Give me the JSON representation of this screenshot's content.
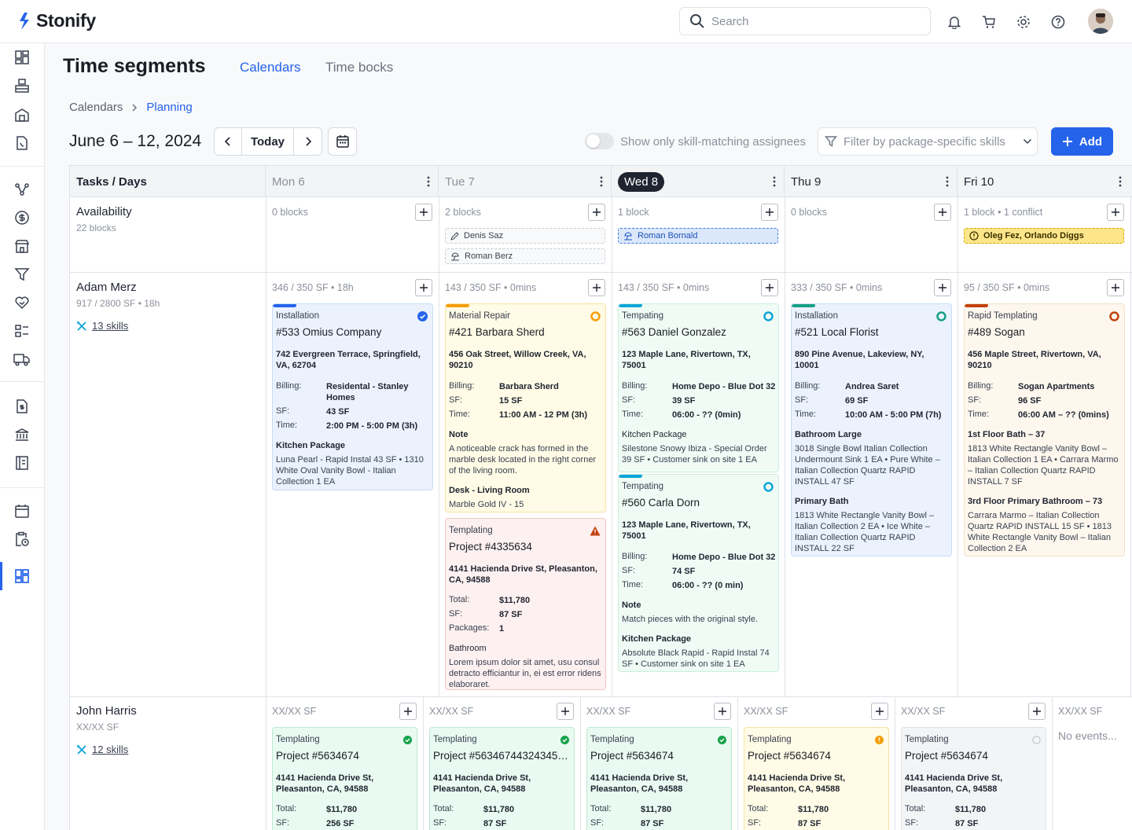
{
  "app": {
    "name": "Stonify"
  },
  "topbar": {
    "search_placeholder": "Search"
  },
  "page": {
    "title": "Time segments",
    "tabs": [
      "Calendars",
      "Time bocks"
    ],
    "active_tab": "Calendars"
  },
  "breadcrumb": {
    "root": "Calendars",
    "current": "Planning"
  },
  "toolbar": {
    "date_range": "June 6 – 12, 2024",
    "today_label": "Today",
    "toggle_label": "Show only skill-matching assignees",
    "filter_placeholder": "Filter by package-specific skills",
    "add_label": "Add"
  },
  "grid": {
    "corner_label": "Tasks / Days",
    "days": [
      {
        "label": "Mon 6",
        "state": "past"
      },
      {
        "label": "Tue 7",
        "state": "past"
      },
      {
        "label": "Wed 8",
        "state": "today"
      },
      {
        "label": "Thu 9",
        "state": "future"
      },
      {
        "label": "Fri 10",
        "state": "future"
      }
    ],
    "availability": {
      "label": "Availability",
      "sub": "22 blocks",
      "cells": [
        {
          "meta": "0 blocks",
          "chips": []
        },
        {
          "meta": "2 blocks",
          "chips": [
            "Denis Saz",
            "Roman Berz"
          ]
        },
        {
          "meta": "1 block",
          "chips": [
            "Roman Bornald"
          ]
        },
        {
          "meta": "0 blocks",
          "chips": []
        },
        {
          "meta": "1 block • 1 conflict",
          "chips": [
            "Oleg Fez, Orlando Diggs"
          ]
        }
      ]
    },
    "rows": [
      {
        "name": "Adam Merz",
        "sub": "917 / 2800 SF • 18h",
        "skills": "13 skills",
        "metas": [
          "346 / 350 SF • 18h",
          "143 / 350 SF • 0mins",
          "143 / 350 SF • 0mins",
          "333 / 350 SF • 0mins",
          "95 / 350 SF • 0mins"
        ],
        "cards": {
          "mon": {
            "type": "Installation",
            "title": "#533 Omius Company",
            "addr": "742 Evergreen Terrace, Springfield, VA, 62704",
            "billing_k": "Billing:",
            "billing": "Residental - Stanley Homes",
            "sf_k": "SF:",
            "sf": "43 SF",
            "time_k": "Time:",
            "time": "2:00 PM - 5:00 PM (3h)",
            "pkg": "Kitchen Package",
            "pkg_text": "Luna Pearl - Rapid Instal 43 SF • 1310 White Oval Vanity Bowl - Italian Collection 1 EA"
          },
          "tue1": {
            "type": "Material Repair",
            "title": "#421 Barbara Sherd",
            "addr": "456 Oak Street, Willow Creek, VA, 90210",
            "billing_k": "Billing:",
            "billing": "Barbara Sherd",
            "sf_k": "SF:",
            "sf": "15 SF",
            "time_k": "Time:",
            "time": "11:00 AM - 12 PM (3h)",
            "note_k": "Note",
            "note": "A noticeable crack has formed in the marble desk located in the right corner of the living room.",
            "pkg": "Desk - Living Room",
            "pkg_text": "Marble Gold IV - 15"
          },
          "tue2": {
            "type": "Templating",
            "title": "Project #4335634",
            "addr": "4141 Hacienda Drive St, Pleasanton, CA, 94588",
            "total_k": "Total:",
            "total": "$11,780",
            "sf_k": "SF:",
            "sf": "87 SF",
            "pk_k": "Packages:",
            "pk": "1",
            "pkg": "Bathroom",
            "pkg_text": "Lorem ipsum dolor sit amet, usu consul detracto efficiantur in, ei est error ridens elaboraret."
          },
          "wed1": {
            "type": "Tempating",
            "title": "#563 Daniel Gonzalez",
            "addr": "123 Maple Lane, Rivertown, TX, 75001",
            "billing_k": "Billing:",
            "billing": "Home Depo - Blue Dot 32",
            "sf_k": "SF:",
            "sf": "39 SF",
            "time_k": "Time:",
            "time": "06:00 - ?? (0min)",
            "pkg": "Kitchen Package",
            "pkg_text": "Silestone Snowy Ibiza - Special Order 39 SF •  Customer sink on site 1 EA"
          },
          "wed2": {
            "type": "Tempating",
            "title": "#560 Carla Dorn",
            "addr": "123 Maple Lane, Rivertown, TX, 75001",
            "billing_k": "Billing:",
            "billing": "Home Depo - Blue Dot 32",
            "sf_k": "SF:",
            "sf": "74 SF",
            "time_k": "Time:",
            "time": "06:00 - ?? (0 min)",
            "note_k": "Note",
            "note": "Match pieces with the original style.",
            "pkg": "Kitchen  Package",
            "pkg_text": "Absolute Black Rapid - Rapid Instal 74 SF •  Customer sink on site 1 EA"
          },
          "thu": {
            "type": "Installation",
            "title": "#521 Local Florist",
            "addr": "890 Pine Avenue, Lakeview, NY, 10001",
            "billing_k": "Billing:",
            "billing": "Andrea Saret",
            "sf_k": "SF:",
            "sf": "69 SF",
            "time_k": "Time:",
            "time": "10:00 AM - 5:00 PM (7h)",
            "pkg": "Bathroom Large",
            "pkg_text": "3018 Single Bowl Italian Collection Undermount Sink   1 EA • Pure White – Italian Collection Quartz RAPID INSTALL   47 SF",
            "pkg2": "Primary Bath",
            "pkg2_text": "1813 White Rectangle Vanity Bowl – Italian Collection    2 EA • Ice White – Italian Collection Quartz RAPID INSTALL   22 SF"
          },
          "fri": {
            "type": "Rapid Templating",
            "title": "#489 Sogan",
            "addr": "456 Maple Street, Rivertown, VA, 90210",
            "billing_k": "Billing:",
            "billing": "Sogan Apartments",
            "sf_k": "SF:",
            "sf": "96 SF",
            "time_k": "Time:",
            "time": "06:00 AM – ?? (0mins)",
            "pkg": "1st Floor Bath – 37",
            "pkg_text": "1813 White Rectangle Vanity Bowl – Italian Collection    1 EA • Carrara Marmo – Italian Collection Quartz RAPID INSTALL   7 SF",
            "pkg2": "3rd Floor Primary Bathroom – 73",
            "pkg2_text": "Carrara Marmo – Italian Collection Quartz RAPID INSTALL   15 SF • 1813 White Rectangle Vanity Bowl – Italian Collection    2 EA"
          }
        }
      },
      {
        "name": "John Harris",
        "sub": "XX/XX SF",
        "skills": "12 skills",
        "metas": [
          "XX/XX SF",
          "XX/XX SF",
          "XX/XX SF",
          "XX/XX SF",
          "XX/XX SF",
          "XX/XX SF"
        ],
        "no_events": "No events...",
        "cards": [
          {
            "type": "Templating",
            "title": "Project #5634674",
            "addr": "4141 Hacienda Drive St, Pleasanton, CA, 94588",
            "total_k": "Total:",
            "total": "$11,780",
            "sf_k": "SF:",
            "sf": "256 SF"
          },
          {
            "type": "Templating",
            "title": "Project #563467443243453...",
            "addr": "4141 Hacienda Drive St, Pleasanton, CA, 94588",
            "total_k": "Total:",
            "total": "$11,780",
            "sf_k": "SF:",
            "sf": "87 SF"
          },
          {
            "type": "Templating",
            "title": "Project #5634674",
            "addr": "4141 Hacienda Drive St, Pleasanton, CA, 94588",
            "total_k": "Total:",
            "total": "$11,780",
            "sf_k": "SF:",
            "sf": "87 SF"
          },
          {
            "type": "Templating",
            "title": "Project #5634674",
            "addr": "4141 Hacienda Drive St, Pleasanton, CA, 94588",
            "total_k": "Total:",
            "total": "$11,780",
            "sf_k": "SF:",
            "sf": "87 SF"
          },
          {
            "type": "Templating",
            "title": "Project #5634674",
            "addr": "4141 Hacienda Drive St, Pleasanton, CA, 94588",
            "total_k": "Total:",
            "total": "$11,780",
            "sf_k": "SF:",
            "sf": "87 SF"
          }
        ]
      }
    ]
  },
  "colors": {
    "accent": "#2563eb",
    "blue": "#2563eb",
    "orange": "#f59e0b",
    "cyan": "#0ea5d9",
    "teal": "#16a085",
    "rust": "#c2410c",
    "red": "#dc2626"
  }
}
